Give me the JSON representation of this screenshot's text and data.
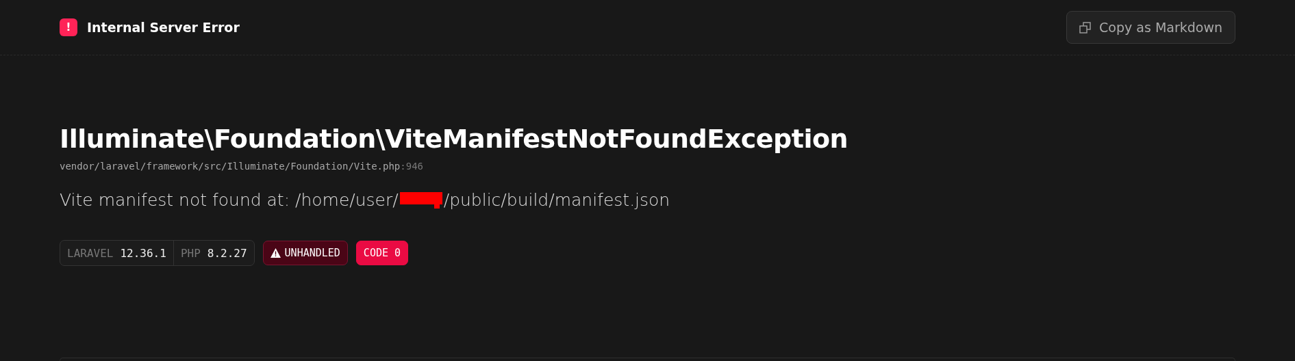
{
  "header": {
    "badge": "!",
    "title": "Internal Server Error",
    "copy_button": "Copy as Markdown"
  },
  "exception": {
    "class": "Illuminate\\Foundation\\ViteManifestNotFoundException",
    "file": "vendor/laravel/framework/src/Illuminate/Foundation/Vite.php",
    "line": ":946",
    "message_start": "Vite manifest not found at: /home/user/",
    "message_end": "/public/build/manifest.json",
    "redacted": true
  },
  "versions": [
    {
      "name": "LARAVEL",
      "value": "12.36.1"
    },
    {
      "name": "PHP",
      "value": "8.2.27"
    }
  ],
  "tags": [
    {
      "kind": "warning",
      "label": "UNHANDLED"
    },
    {
      "kind": "code",
      "label": "CODE 0"
    }
  ]
}
